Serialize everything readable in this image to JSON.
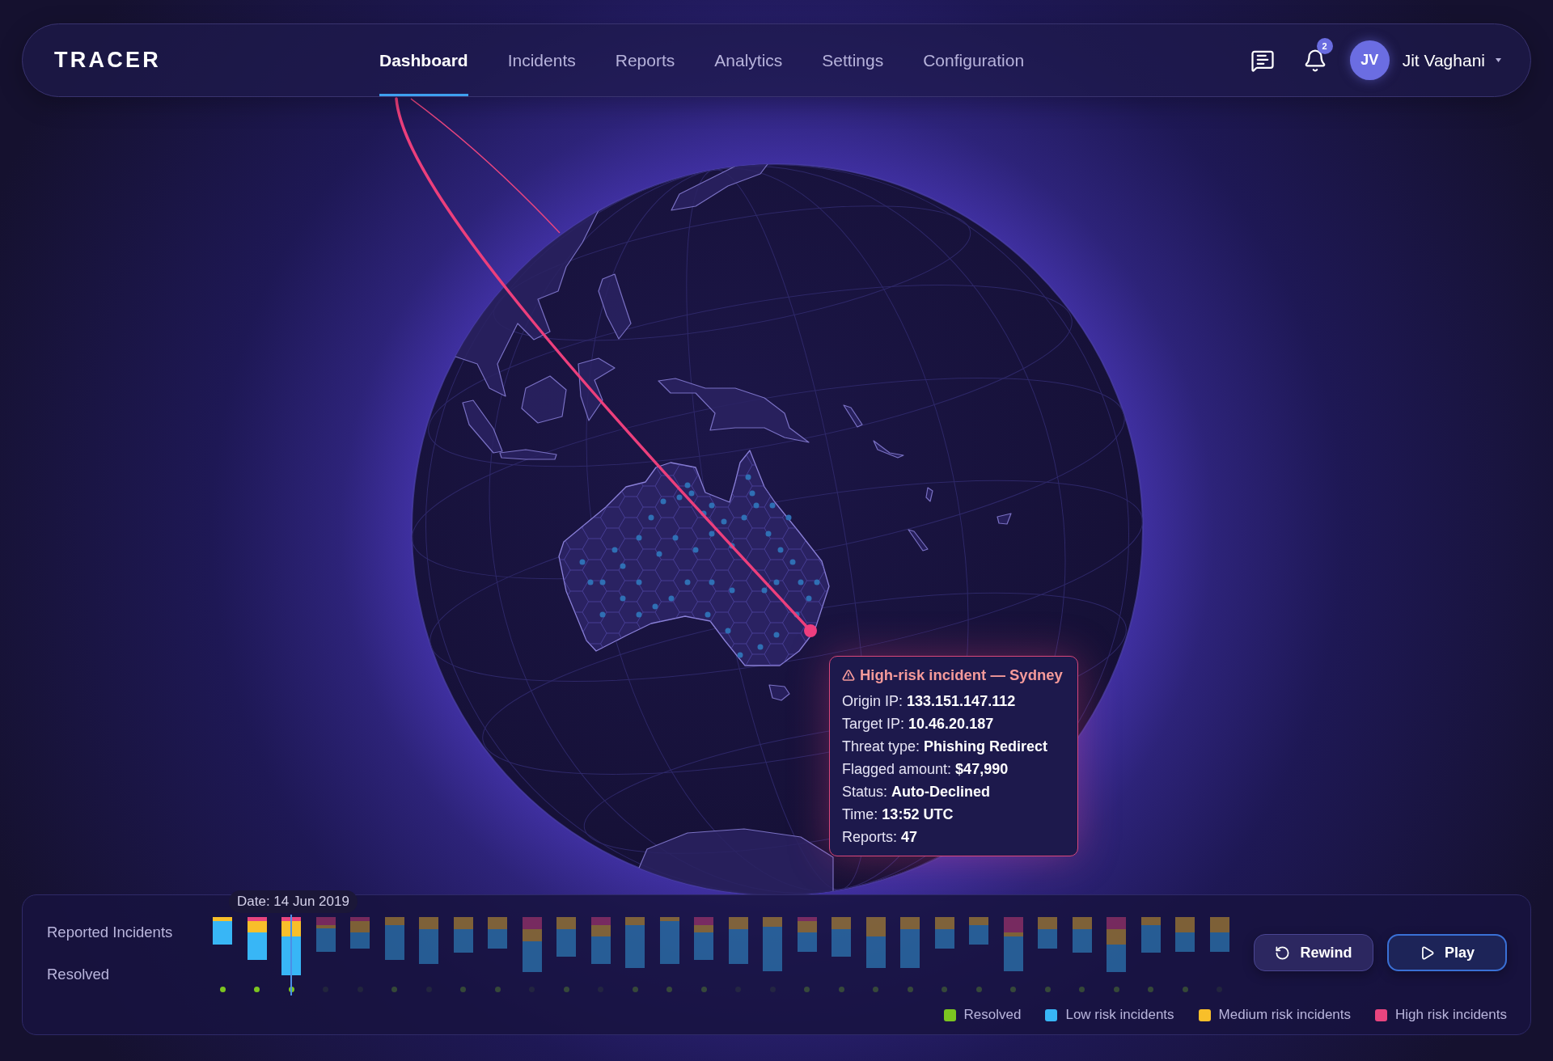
{
  "header": {
    "logo": "TRACER",
    "nav": [
      {
        "label": "Dashboard",
        "selected": true
      },
      {
        "label": "Incidents",
        "selected": false
      },
      {
        "label": "Reports",
        "selected": false
      },
      {
        "label": "Analytics",
        "selected": false
      },
      {
        "label": "Settings",
        "selected": false
      },
      {
        "label": "Configuration",
        "selected": false
      }
    ],
    "notification_count": "2",
    "user": {
      "initials": "JV",
      "name": "Jit Vaghani"
    }
  },
  "map": {
    "tooltip": {
      "title": "High-risk incident — Sydney",
      "fields": [
        {
          "label": "Origin IP:",
          "value": "133.151.147.112"
        },
        {
          "label": "Target IP:",
          "value": "10.46.20.187"
        },
        {
          "label": "Threat type:",
          "value": "Phishing Redirect"
        },
        {
          "label": "Flagged amount:",
          "value": "$47,990"
        },
        {
          "label": "Status:",
          "value": "Auto-Declined"
        },
        {
          "label": "Time:",
          "value": "13:52 UTC"
        },
        {
          "label": "Reports:",
          "value": "47"
        }
      ]
    }
  },
  "timeline": {
    "date": "Date: 14 Jun 2019",
    "row_labels": [
      "Reported Incidents",
      "Resolved"
    ],
    "buttons": [
      {
        "label": "Rewind",
        "kind": "rewind"
      },
      {
        "label": "Play",
        "kind": "play"
      }
    ],
    "legend": [
      {
        "label": "Resolved",
        "color": "#7cc520"
      },
      {
        "label": "Low risk incidents",
        "color": "#38b6f6"
      },
      {
        "label": "Medium risk incidents",
        "color": "#f8bf2a"
      },
      {
        "label": "High risk incidents",
        "color": "#e8457f"
      }
    ]
  }
}
